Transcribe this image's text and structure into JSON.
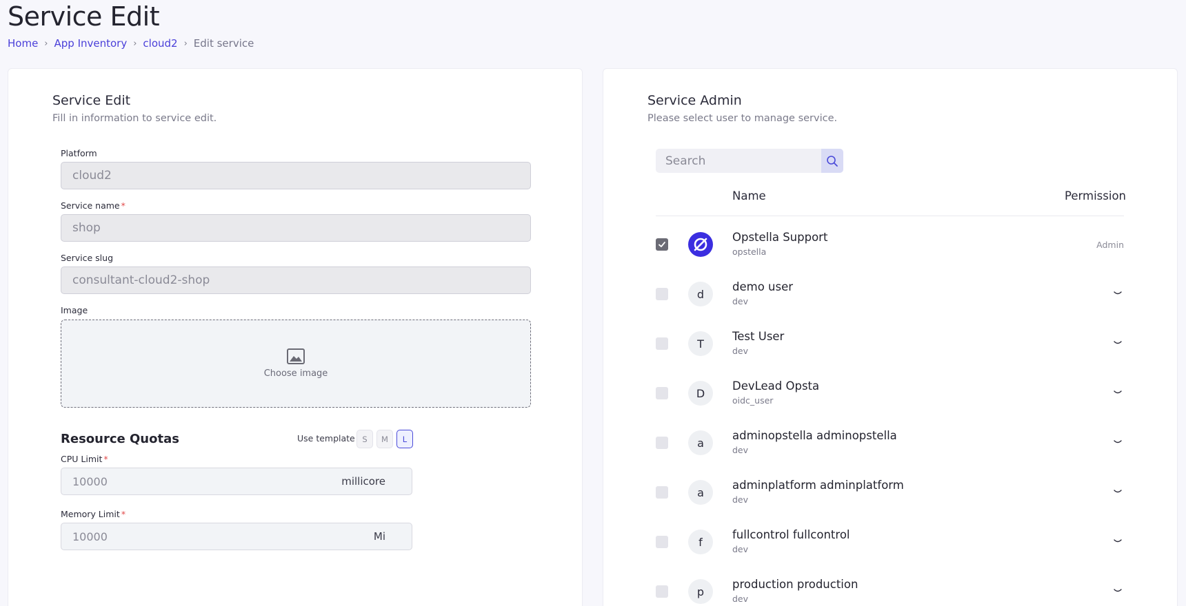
{
  "page": {
    "title": "Service Edit"
  },
  "breadcrumb": {
    "items": [
      "Home",
      "App Inventory",
      "cloud2"
    ],
    "current": "Edit service"
  },
  "edit_card": {
    "title": "Service Edit",
    "subtitle": "Fill in information to service edit.",
    "platform": {
      "label": "Platform",
      "value": "cloud2"
    },
    "service_name": {
      "label": "Service name",
      "required": "*",
      "value": "shop"
    },
    "service_slug": {
      "label": "Service slug",
      "value": "consultant-cloud2-shop"
    },
    "image": {
      "label": "Image",
      "choose_label": "Choose image"
    },
    "resource_quotas": {
      "title": "Resource Quotas",
      "use_template_label": "Use template",
      "templates": [
        "S",
        "M",
        "L"
      ],
      "selected_template": "L",
      "cpu": {
        "label": "CPU Limit",
        "required": "*",
        "value": "10000",
        "unit": "millicore"
      },
      "memory": {
        "label": "Memory Limit",
        "required": "*",
        "value": "10000",
        "unit": "Mi"
      }
    }
  },
  "admin_card": {
    "title": "Service Admin",
    "subtitle": "Please select user to manage service.",
    "search_placeholder": "Search",
    "columns": {
      "name": "Name",
      "permission": "Permission"
    },
    "users": [
      {
        "name": "Opstella Support",
        "sub": "opstella",
        "avatar": "",
        "checked": true,
        "permission": "Admin"
      },
      {
        "name": "demo user",
        "sub": "dev",
        "avatar": "d",
        "checked": false,
        "permission": ""
      },
      {
        "name": "Test User",
        "sub": "dev",
        "avatar": "T",
        "checked": false,
        "permission": ""
      },
      {
        "name": "DevLead Opsta",
        "sub": "oidc_user",
        "avatar": "D",
        "checked": false,
        "permission": ""
      },
      {
        "name": "adminopstella adminopstella",
        "sub": "dev",
        "avatar": "a",
        "checked": false,
        "permission": ""
      },
      {
        "name": "adminplatform adminplatform",
        "sub": "dev",
        "avatar": "a",
        "checked": false,
        "permission": ""
      },
      {
        "name": "fullcontrol fullcontrol",
        "sub": "dev",
        "avatar": "f",
        "checked": false,
        "permission": ""
      },
      {
        "name": "production production",
        "sub": "dev",
        "avatar": "p",
        "checked": false,
        "permission": ""
      }
    ]
  },
  "colors": {
    "accent": "#4a3fd9",
    "logo_bg": "#3b2ee0",
    "required": "#e24a4a"
  }
}
